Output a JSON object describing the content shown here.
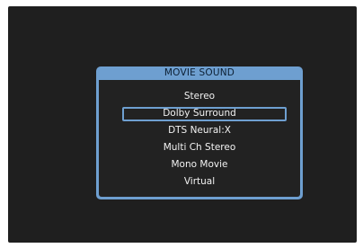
{
  "menu": {
    "title": "MOVIE SOUND",
    "items": [
      {
        "label": "Stereo",
        "selected": false
      },
      {
        "label": "Dolby Surround",
        "selected": true
      },
      {
        "label": "DTS Neural:X",
        "selected": false
      },
      {
        "label": "Multi Ch Stereo",
        "selected": false
      },
      {
        "label": "Mono Movie",
        "selected": false
      },
      {
        "label": "Virtual",
        "selected": false
      }
    ]
  },
  "colors": {
    "screen_background": "#1f1f1f",
    "menu_frame": "#6e9fd0",
    "menu_body": "#222222",
    "text": "#f2f2f2"
  }
}
